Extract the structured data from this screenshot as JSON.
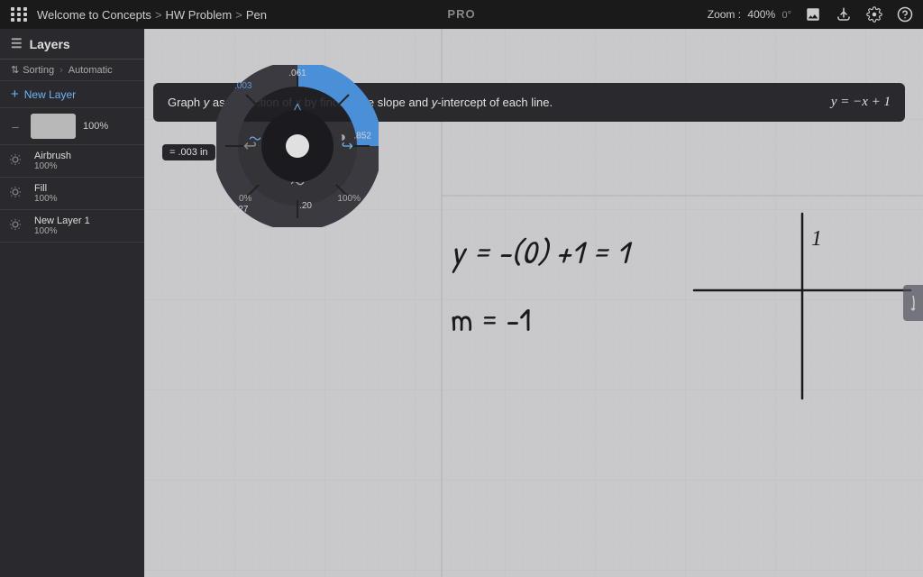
{
  "topbar": {
    "breadcrumb": {
      "home": "Welcome to Concepts",
      "sep1": ">",
      "folder": "HW Problem",
      "sep2": ">",
      "item": "Pen"
    },
    "pro_label": "PRO",
    "zoom_label": "Zoom :",
    "zoom_value": "400%",
    "zoom_angle": "0°",
    "icons": {
      "apps": "apps",
      "image": "image",
      "share": "share",
      "settings": "settings",
      "help": "help"
    }
  },
  "instruction": {
    "text": "Graph y as a function of x by finding the slope and y-intercept of each line.",
    "formula": "y = −x + 1"
  },
  "canvas": {
    "equation1": "y = -(0) +1 = 1",
    "equation2": "m = -1",
    "cross_label": "1"
  },
  "brush_wheel": {
    "size_label": "= .003 in",
    "size_top": ".061",
    "size_tl": ".003",
    "size_right": ".852",
    "size_bl": ".227",
    "size_bottom": ".20",
    "pct_left": "0%",
    "pct_right": "100%"
  },
  "layers": {
    "title": "Layers",
    "sorting_label": "Sorting",
    "sorting_mode": "Automatic",
    "new_layer_label": "New Layer",
    "items": [
      {
        "name": "Airbrush",
        "pct": "100%",
        "visible": true
      },
      {
        "name": "Fill",
        "pct": "100%",
        "visible": true
      },
      {
        "name": "New Layer 1",
        "pct": "100%",
        "visible": true
      }
    ]
  }
}
